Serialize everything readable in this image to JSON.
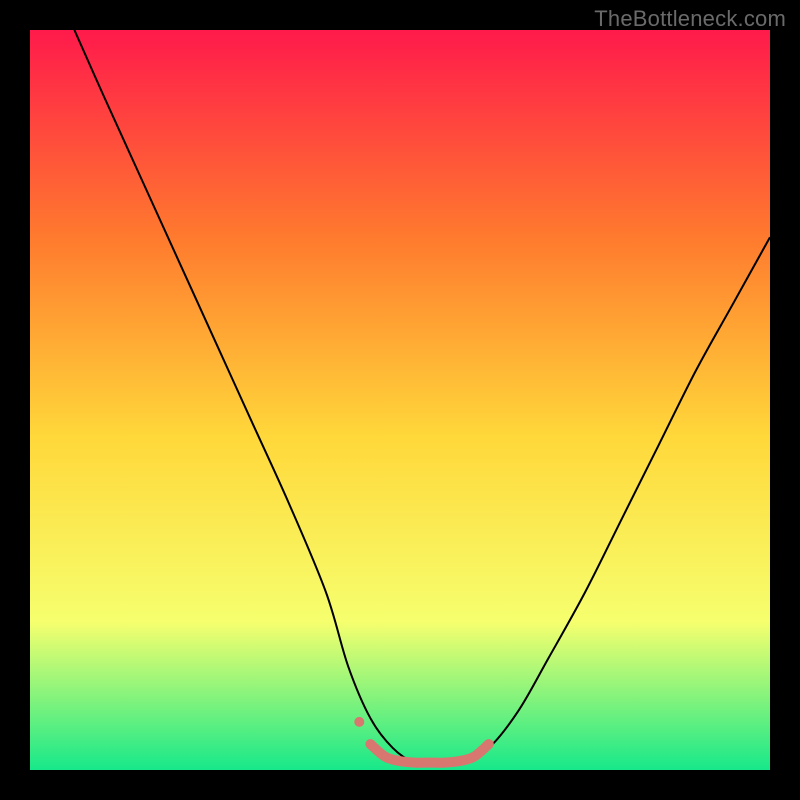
{
  "watermark": "TheBottleneck.com",
  "chart_data": {
    "type": "line",
    "title": "",
    "xlabel": "",
    "ylabel": "",
    "xlim": [
      0,
      100
    ],
    "ylim": [
      0,
      100
    ],
    "grid": false,
    "legend": false,
    "background_gradient": {
      "top": "#ff1a4b",
      "mid_upper": "#ff7a2e",
      "mid": "#ffd83a",
      "mid_lower": "#f6ff6e",
      "bottom": "#17e88a"
    },
    "series": [
      {
        "name": "v-curve",
        "color": "#000000",
        "stroke_width": 2,
        "x": [
          6,
          10,
          15,
          20,
          25,
          30,
          35,
          40,
          43,
          46,
          49,
          52,
          55,
          58,
          62,
          66,
          70,
          75,
          80,
          85,
          90,
          95,
          100
        ],
        "y": [
          100,
          91,
          80,
          69,
          58,
          47,
          36,
          24,
          14,
          7,
          3,
          1,
          1,
          1,
          3,
          8,
          15,
          24,
          34,
          44,
          54,
          63,
          72
        ]
      },
      {
        "name": "bottom-highlight",
        "color": "#d8776f",
        "stroke_width": 10,
        "linecap": "round",
        "x": [
          46,
          48,
          50,
          52,
          54,
          56,
          58,
          60,
          62
        ],
        "y": [
          3.5,
          1.8,
          1.2,
          1.0,
          1.0,
          1.0,
          1.2,
          1.8,
          3.5
        ]
      }
    ],
    "markers": [
      {
        "x": 44.5,
        "y": 6.5,
        "r": 5,
        "color": "#d8776f"
      }
    ]
  }
}
